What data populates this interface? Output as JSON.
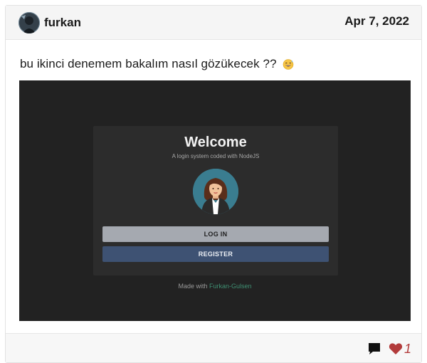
{
  "post": {
    "author": "furkan",
    "date": "Apr 7, 2022",
    "text": "bu ikinci denemem bakalım nasıl gözükecek ??",
    "emoji": "grinning-sweat-emoji"
  },
  "screenshot": {
    "title": "Welcome",
    "subtitle": "A login system coded with NodeJS",
    "login_label": "LOG IN",
    "register_label": "REGISTER",
    "made_with_prefix": "Made with",
    "made_with_author": "Furkan-Gulsen"
  },
  "footer": {
    "comment_icon": "comment-icon",
    "like_icon": "heart-icon",
    "like_count": "1"
  },
  "colors": {
    "like_accent": "#b23b3b",
    "register_button": "#3e5273",
    "login_button": "#a5a9b0",
    "author_link": "#3f8f72"
  }
}
